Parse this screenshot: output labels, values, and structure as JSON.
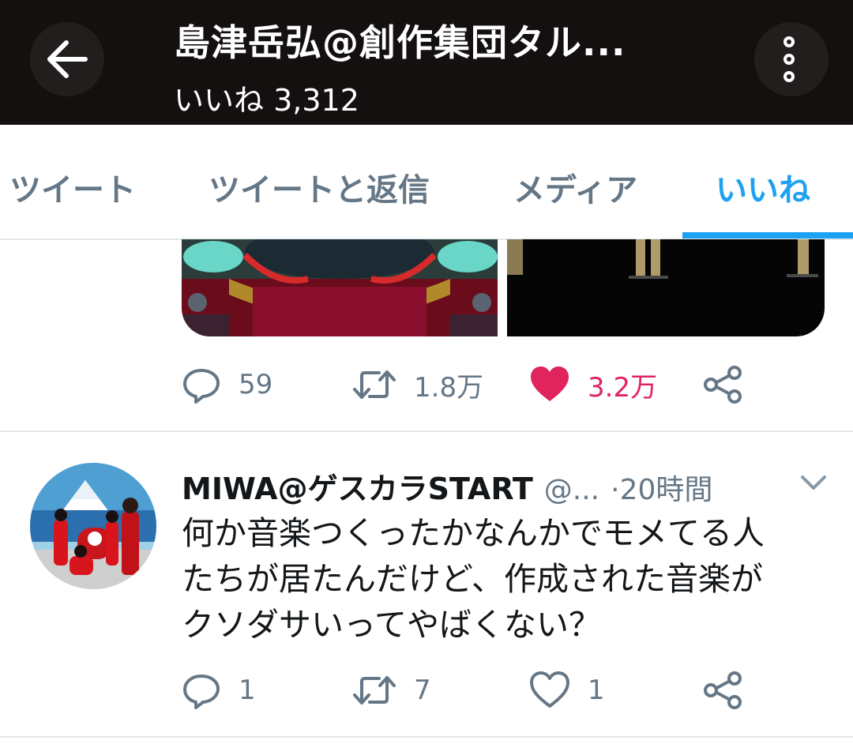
{
  "header": {
    "title": "島津岳弘@創作集団タル...",
    "subtitle": "いいね 3,312",
    "back_icon": "arrow-left-icon",
    "more_icon": "vertical-ellipsis-icon",
    "background": "#141010"
  },
  "tabs": [
    {
      "label": "ツイート",
      "active": false
    },
    {
      "label": "ツイートと返信",
      "active": false
    },
    {
      "label": "メディア",
      "active": false
    },
    {
      "label": "いいね",
      "active": true
    }
  ],
  "tweet1": {
    "actions": {
      "reply_count": "59",
      "retweet_count": "1.8万",
      "like_count": "3.2万",
      "liked": true
    }
  },
  "tweet2": {
    "name": "MIWA@ゲスカラSTART",
    "handle": "@...",
    "separator": "·",
    "time": "20時間",
    "text_lines": [
      "何か音楽つくったかなんかでモメてる人",
      "たちが居たんだけど、作成された音楽が",
      "クソダサいってやばくない？"
    ],
    "actions": {
      "reply_count": "1",
      "retweet_count": "7",
      "like_count": "1",
      "liked": false
    }
  },
  "colors": {
    "accent": "#1da1f2",
    "like": "#e0245e",
    "secondary_text": "#657786",
    "divider": "#e1e8ed"
  }
}
